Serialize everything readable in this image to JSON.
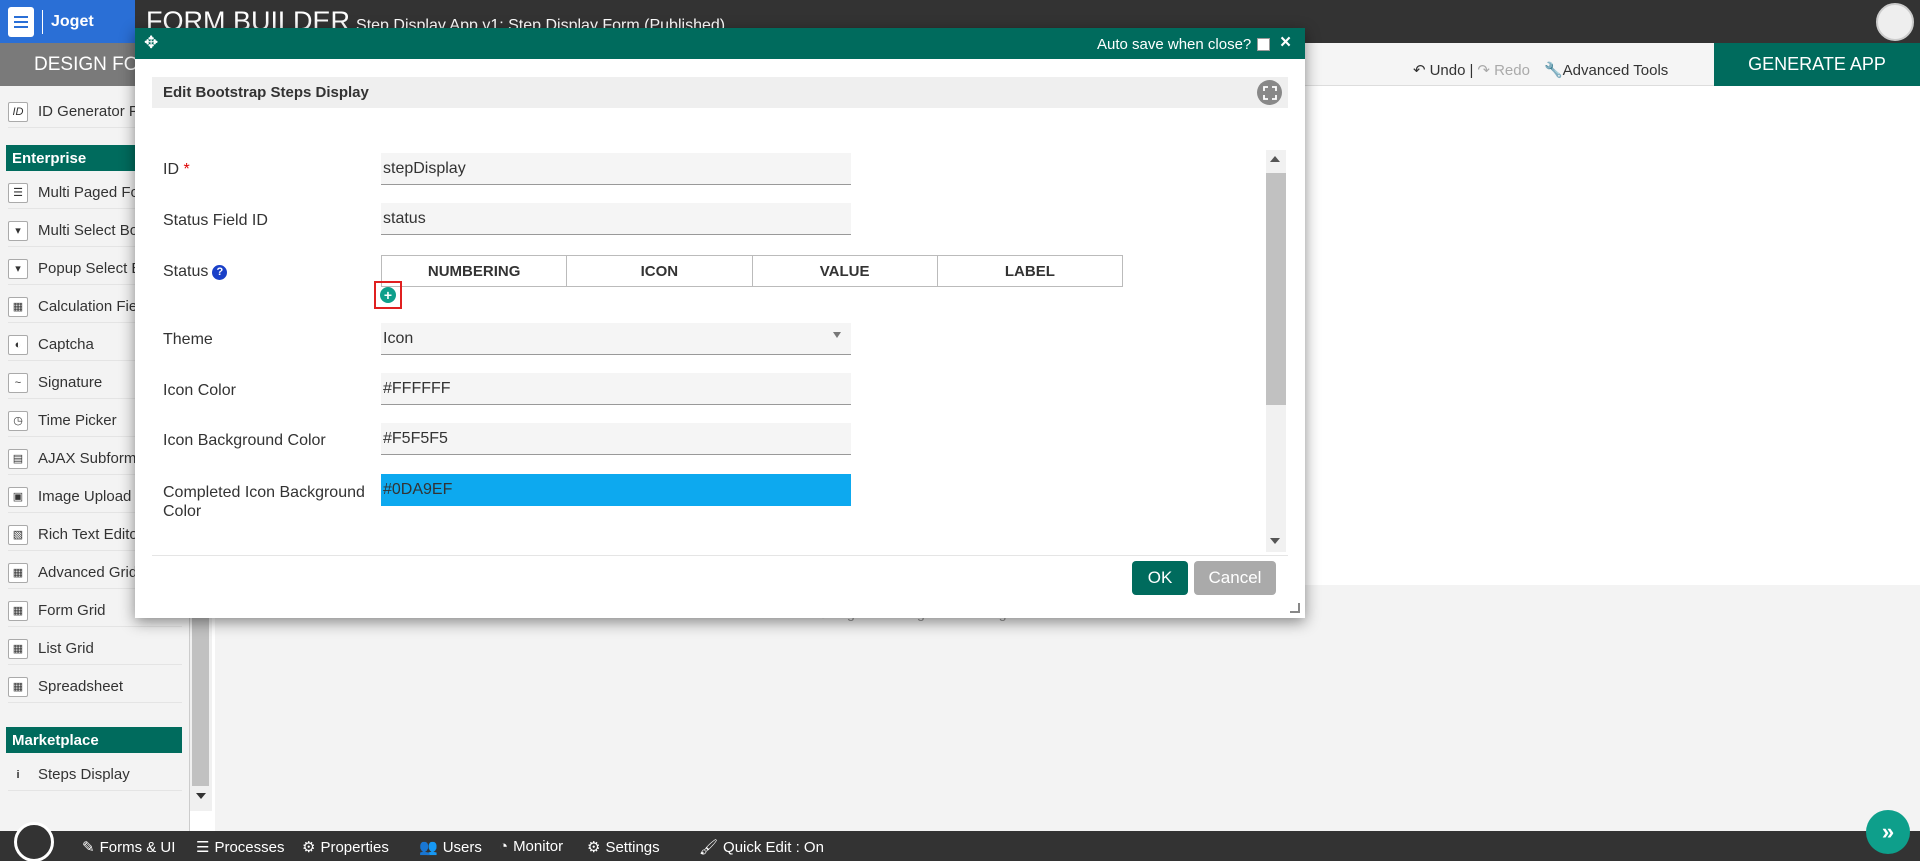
{
  "header": {
    "logo_text": "Joget",
    "title": "FORM BUILDER",
    "subtitle": "Step Display App v1: Step Display Form (Published)"
  },
  "toolbar": {
    "design_tab": "DESIGN FORM",
    "undo": "Undo",
    "separator": "|",
    "redo": "Redo",
    "advanced_tools": "Advanced Tools",
    "generate_app": "GENERATE APP"
  },
  "palette": {
    "top_items": [
      {
        "label": "ID Generator Field",
        "icon": "id-icon"
      }
    ],
    "enterprise_header": "Enterprise",
    "enterprise_items": [
      {
        "label": "Multi Paged Form",
        "icon": "list-icon"
      },
      {
        "label": "Multi Select Box",
        "icon": "dropdown-icon"
      },
      {
        "label": "Popup Select Box",
        "icon": "dropdown-icon"
      },
      {
        "label": "Calculation Field",
        "icon": "calculator-icon"
      },
      {
        "label": "Captcha",
        "icon": "shield-icon"
      },
      {
        "label": "Signature",
        "icon": "signature-icon"
      },
      {
        "label": "Time Picker",
        "icon": "clock-icon"
      },
      {
        "label": "AJAX Subform",
        "icon": "file-icon"
      },
      {
        "label": "Image Upload",
        "icon": "image-icon"
      },
      {
        "label": "Rich Text Editor",
        "icon": "editor-icon"
      },
      {
        "label": "Advanced Grid",
        "icon": "grid-icon"
      },
      {
        "label": "Form Grid",
        "icon": "grid-icon"
      },
      {
        "label": "List Grid",
        "icon": "grid-icon"
      },
      {
        "label": "Spreadsheet",
        "icon": "grid-icon"
      }
    ],
    "marketplace_header": "Marketplace",
    "marketplace_items": [
      {
        "label": "Steps Display",
        "icon": "info-icon"
      }
    ]
  },
  "canvas": {
    "copyright": "© Joget DX - Joget Inc. All Rights Reserved."
  },
  "dialog": {
    "autosave_label": "Auto save when close?",
    "close": "×",
    "heading": "Edit Bootstrap Steps Display",
    "fields": {
      "id_label": "ID",
      "id_required": "*",
      "id_value": "stepDisplay",
      "status_field_label": "Status Field ID",
      "status_field_value": "status",
      "status_label": "Status",
      "status_columns": [
        "NUMBERING",
        "ICON",
        "VALUE",
        "LABEL"
      ],
      "theme_label": "Theme",
      "theme_value": "Icon",
      "icon_color_label": "Icon Color",
      "icon_color_value": "#FFFFFF",
      "icon_bg_label": "Icon Background Color",
      "icon_bg_value": "#F5F5F5",
      "completed_bg_label": "Completed Icon Background Color",
      "completed_bg_value": "#0DA9EF"
    },
    "ok": "OK",
    "cancel": "Cancel"
  },
  "bottombar": {
    "items": [
      "Forms & UI",
      "Processes",
      "Properties",
      "Users",
      "Monitor",
      "Settings"
    ],
    "quick_edit": "Quick Edit : On"
  },
  "colors": {
    "brand_green": "#006b5d",
    "accent_teal": "#0e9f8b",
    "completed_blue": "#0DA9EF",
    "header_dark": "#333333",
    "logo_blue": "#2a6fd6"
  }
}
